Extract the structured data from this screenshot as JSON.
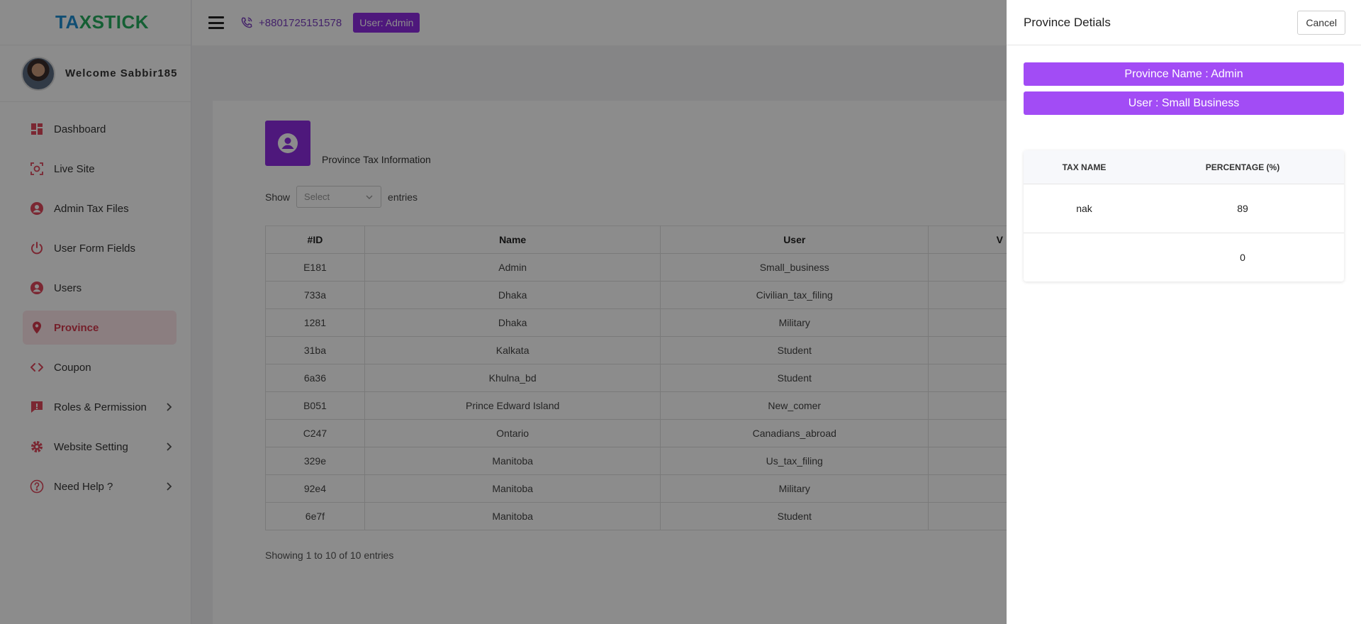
{
  "brand": {
    "logo_part1": "TA",
    "logo_part2": "XSTICK"
  },
  "sidebar": {
    "welcome": "Welcome Sabbir185",
    "items": [
      {
        "label": "Dashboard",
        "icon": "dashboard-icon"
      },
      {
        "label": "Live Site",
        "icon": "camera-icon"
      },
      {
        "label": "Admin Tax Files",
        "icon": "user-circle-icon"
      },
      {
        "label": "User Form Fields",
        "icon": "power-icon"
      },
      {
        "label": "Users",
        "icon": "user-circle-icon"
      },
      {
        "label": "Province",
        "icon": "map-pin-icon"
      },
      {
        "label": "Coupon",
        "icon": "code-icon"
      },
      {
        "label": "Roles & Permission",
        "icon": "alert-message-icon"
      },
      {
        "label": "Website Setting",
        "icon": "gear-icon"
      },
      {
        "label": "Need Help ?",
        "icon": "help-circle-icon"
      }
    ]
  },
  "topbar": {
    "phone": "+8801725151578",
    "user_badge": "User:  Admin"
  },
  "main": {
    "title": "Province Tax Information",
    "show_label": "Show",
    "select_placeholder": "Select",
    "entries_label": "entries",
    "columns": [
      "#ID",
      "Name",
      "User",
      "V"
    ],
    "rows": [
      [
        "E181",
        "Admin",
        "Small_business"
      ],
      [
        "733a",
        "Dhaka",
        "Civilian_tax_filing"
      ],
      [
        "1281",
        "Dhaka",
        "Military"
      ],
      [
        "31ba",
        "Kalkata",
        "Student"
      ],
      [
        "6a36",
        "Khulna_bd",
        "Student"
      ],
      [
        "B051",
        "Prince Edward Island",
        "New_comer"
      ],
      [
        "C247",
        "Ontario",
        "Canadians_abroad"
      ],
      [
        "329e",
        "Manitoba",
        "Us_tax_filing"
      ],
      [
        "92e4",
        "Manitoba",
        "Military"
      ],
      [
        "6e7f",
        "Manitoba",
        "Student"
      ]
    ],
    "showing": "Showing 1 to 10 of 10 entries"
  },
  "drawer": {
    "title": "Province Detials",
    "cancel": "Cancel",
    "province_name": "Province Name : Admin",
    "user": "User : Small Business",
    "headers": [
      "TAX NAME",
      "PERCENTAGE (%)"
    ],
    "rows": [
      [
        "nak",
        "89"
      ],
      [
        "",
        "0"
      ]
    ]
  },
  "colors": {
    "accent": "#8e2de2",
    "pill": "#a24cf5",
    "active_bg": "#fde5ea",
    "active_text": "#d63a4e"
  }
}
